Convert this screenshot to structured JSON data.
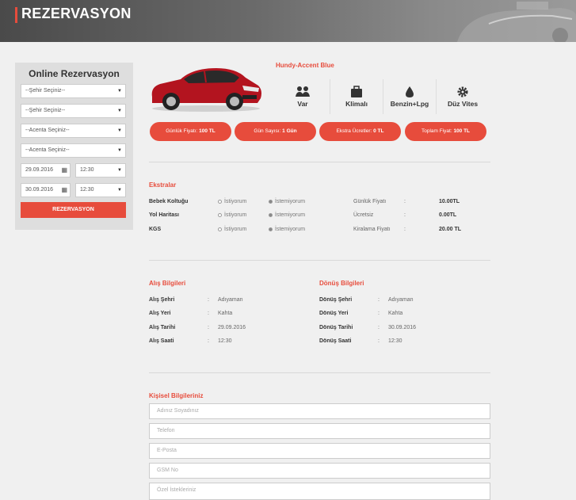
{
  "header": {
    "title": "REZERVASYON"
  },
  "sidebar": {
    "title": "Online Rezervasyon",
    "selects": [
      "--Şehir Seçiniz--",
      "--Şehir Seçiniz--",
      "--Acenta Seçiniz--",
      "--Acenta Seçiniz--"
    ],
    "pickup_date": "29.09.2016",
    "pickup_time": "12:30",
    "return_date": "30.09.2016",
    "return_time": "12:30",
    "submit_label": "REZERVASYON"
  },
  "car": {
    "name": "Hundy-Accent Blue",
    "features": [
      {
        "icon": "users-icon",
        "label": "Var"
      },
      {
        "icon": "briefcase-icon",
        "label": "Klimalı"
      },
      {
        "icon": "fuel-drop-icon",
        "label": "Benzin+Lpg"
      },
      {
        "icon": "gear-icon",
        "label": "Düz Vites"
      }
    ],
    "pills": [
      {
        "label": "Günlük Fiyatı:",
        "value": "100 TL"
      },
      {
        "label": "Gün Sayısı:",
        "value": "1 Gün"
      },
      {
        "label": "Ekstra Ücretler:",
        "value": "0 TL"
      },
      {
        "label": "Toplam Fiyat:",
        "value": "100 TL"
      }
    ]
  },
  "extras": {
    "title": "Ekstralar",
    "opt_yes": "İstiyorum",
    "opt_no": "İstemiyorum",
    "colon": ":",
    "rows": [
      {
        "name": "Bebek Koltuğu",
        "price_label": "Günlük Fiyatı",
        "price": "10.00TL"
      },
      {
        "name": "Yol Haritası",
        "price_label": "Ücretsiz",
        "price": "0.00TL"
      },
      {
        "name": "KGS",
        "price_label": "Kiralama Fiyatı",
        "price": "20.00 TL"
      }
    ]
  },
  "pickup": {
    "title": "Alış Bilgileri",
    "rows": [
      {
        "label": "Alış Şehri",
        "value": "Adıyaman"
      },
      {
        "label": "Alış Yeri",
        "value": "Kahta"
      },
      {
        "label": "Alış Tarihi",
        "value": "29.09.2016"
      },
      {
        "label": "Alış Saati",
        "value": "12:30"
      }
    ]
  },
  "return": {
    "title": "Dönüş Bilgileri",
    "rows": [
      {
        "label": "Dönüş Şehri",
        "value": "Adıyaman"
      },
      {
        "label": "Dönüş Yeri",
        "value": "Kahta"
      },
      {
        "label": "Dönüş Tarihi",
        "value": "30.09.2016"
      },
      {
        "label": "Dönüş Saati",
        "value": "12:30"
      }
    ]
  },
  "personal": {
    "title": "Kişisel Bilgileriniz",
    "placeholders": [
      "Adınız Soyadınız",
      "Telefon",
      "E-Posta",
      "GSM No",
      "Özel İstekleriniz"
    ]
  },
  "colors": {
    "accent": "#e74c3c",
    "sidebar_bg": "#dedede",
    "page_bg": "#f0f0f0"
  }
}
